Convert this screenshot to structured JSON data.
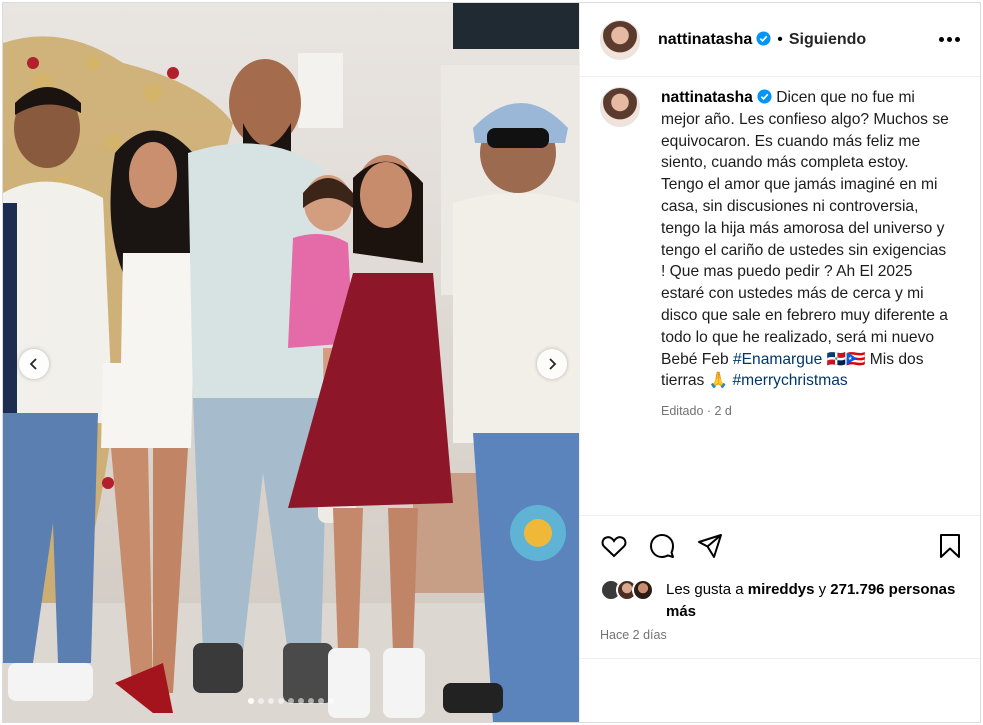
{
  "post": {
    "username": "nattinatasha",
    "follow_status": "Siguiendo",
    "separator": "•",
    "caption_text": "Dicen que no fue mi mejor año. Les confieso algo? Muchos se equivocaron. Es cuando más feliz me siento, cuando más completa estoy. Tengo el amor que jamás imaginé en mi casa, sin discusiones ni controversia, tengo la hija más amorosa del universo y tengo el cariño de ustedes sin exigencias ! Que mas puedo pedir ? Ah El 2025 estaré con ustedes más de cerca y mi disco que sale en febrero muy diferente a todo lo que he realizado, será mi nuevo Bebé Feb",
    "hashtag_1": "#Enamargue",
    "caption_flag": "🇩🇴🇵🇷",
    "caption_line_end": "Mis dos tierras",
    "prayer_emoji": "🙏",
    "hashtag_2": "#merrychristmas",
    "edited_meta": "Editado · 2 d",
    "likes_prefix": "Les gusta a",
    "likes_user": "mireddys",
    "likes_joiner": "y",
    "likes_count": "271.796 personas más",
    "posted_time": "Hace 2 días"
  },
  "carousel": {
    "total_slides": 9,
    "active_slide": 1
  },
  "icons": {
    "verified": "verified-badge-icon",
    "more": "more-options-icon",
    "like": "heart-icon",
    "comment": "comment-icon",
    "share": "paper-plane-icon",
    "save": "bookmark-icon",
    "prev": "chevron-left-icon",
    "next": "chevron-right-icon"
  },
  "colors": {
    "verified_blue": "#0095f6",
    "hashtag": "#00376b",
    "muted": "#737373",
    "border": "#efefef"
  }
}
